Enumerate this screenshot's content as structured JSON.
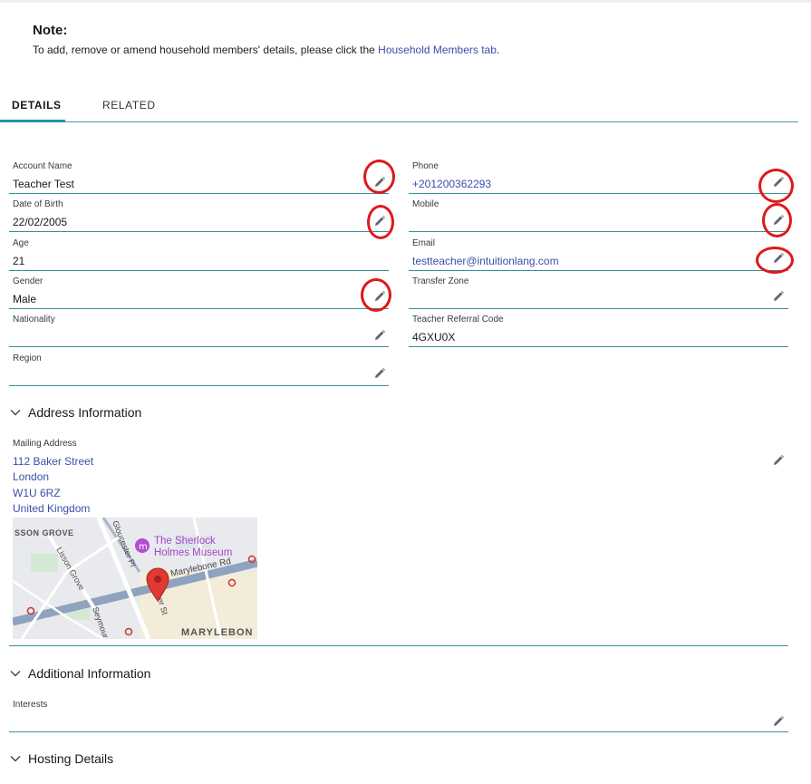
{
  "note": {
    "title": "Note:",
    "text_before": "To add, remove or amend household members' details, please click the ",
    "link_text": "Household Members tab",
    "text_after": "."
  },
  "tabs": [
    {
      "label": "DETAILS",
      "active": true
    },
    {
      "label": "RELATED",
      "active": false
    }
  ],
  "fields": {
    "account_name": {
      "label": "Account Name",
      "value": "Teacher Test"
    },
    "date_of_birth": {
      "label": "Date of Birth",
      "value": "22/02/2005"
    },
    "age": {
      "label": "Age",
      "value": "21"
    },
    "gender": {
      "label": "Gender",
      "value": "Male"
    },
    "nationality": {
      "label": "Nationality",
      "value": ""
    },
    "region": {
      "label": "Region",
      "value": ""
    },
    "phone": {
      "label": "Phone",
      "value": "+201200362293"
    },
    "mobile": {
      "label": "Mobile",
      "value": ""
    },
    "email": {
      "label": "Email",
      "value": "testteacher@intuitionlang.com"
    },
    "transfer_zone": {
      "label": "Transfer Zone",
      "value": ""
    },
    "teacher_referral_code": {
      "label": "Teacher Referral Code",
      "value": "4GXU0X"
    }
  },
  "sections": {
    "address": "Address Information",
    "additional": "Additional Information",
    "hosting": "Hosting Details"
  },
  "address": {
    "label": "Mailing Address",
    "lines": [
      "112 Baker Street",
      "London",
      "W1U 6RZ",
      "United Kingdom"
    ]
  },
  "map": {
    "museum_line1": "The Sherlock",
    "museum_line2": "Holmes Museum",
    "street_marylebone_rd": "Marylebone Rd",
    "street_baker": "Baker St",
    "street_gloucester": "Gloucester Pl",
    "street_lisson": "Lisson Grove",
    "street_seymour": "Seymour",
    "area_lisson": "SSON GROVE",
    "area_marylebone": "MARYLEBON"
  },
  "interests": {
    "label": "Interests",
    "value": ""
  },
  "colors": {
    "link": "#3a4fa8",
    "accent_line": "#3b8f97",
    "annotation_circle": "#e01818"
  }
}
